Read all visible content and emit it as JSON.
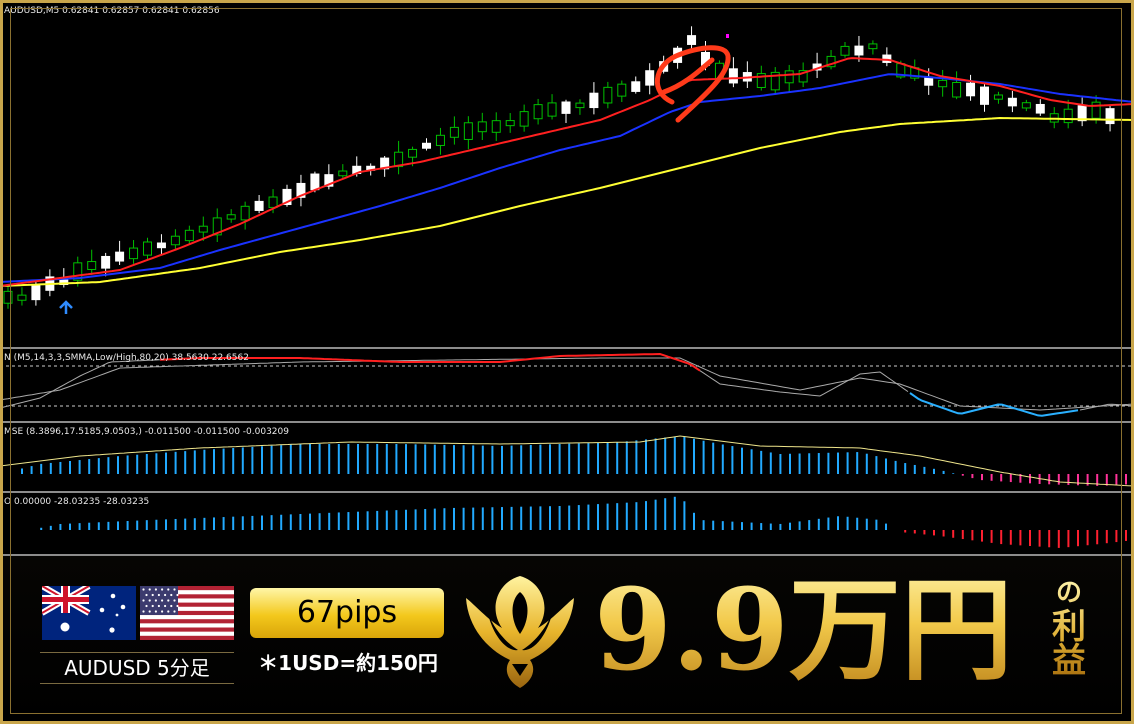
{
  "main_chart": {
    "label": "AUDUSD,M5  0.62841 0.62857 0.62841 0.62856",
    "symbol": "AUDUSD",
    "timeframe": "M5",
    "ohlc": [
      0.62841,
      0.62857,
      0.62841,
      0.62856
    ],
    "candle_count": 80,
    "colors": {
      "bull": "#00c000",
      "bear": "#ffffff",
      "ma_fast": "#ff2020",
      "ma_mid": "#1a32ff",
      "ma_slow": "#ffff33",
      "entry_arrow": "#2f8cff",
      "exit_marker": "#ff00ff",
      "circle_mark": "#ff3a1a"
    },
    "icons": [
      "buy-arrow-icon",
      "exit-marker-icon",
      "circle-highlight-icon"
    ]
  },
  "indicator1": {
    "label": "N (M5,14,3,3,SMMA,Low/High,80,20) 38.5630 22.6562",
    "colors": {
      "main": "#ff2020",
      "signal": "#aaaaaa",
      "low": "#2ab0ff",
      "level": "#cccccc"
    }
  },
  "indicator2": {
    "label": "MSE (8.3896,17.5185,9.0503,) -0.011500 -0.011500 -0.003209",
    "colors": {
      "bar_pos": "#22aaff",
      "bar_neg": "#ff3399",
      "line": "#f0e68c"
    }
  },
  "indicator3": {
    "label": "O 0.00000 -28.03235 -28.03235",
    "colors": {
      "bar_pos": "#22aaff",
      "bar_neg": "#ff2030"
    }
  },
  "banner": {
    "flags": [
      "australia-flag-icon",
      "us-flag-icon"
    ],
    "pair_label": "AUDUSD 5分足",
    "pips_label": "67pips",
    "rate_note": "＊1USD=約150円",
    "profit_amount": "9.9万円",
    "profit_suffix": [
      "の",
      "利",
      "益"
    ],
    "colors": {
      "gold": "#f0c33a",
      "frame": "#c9a64b"
    }
  }
}
